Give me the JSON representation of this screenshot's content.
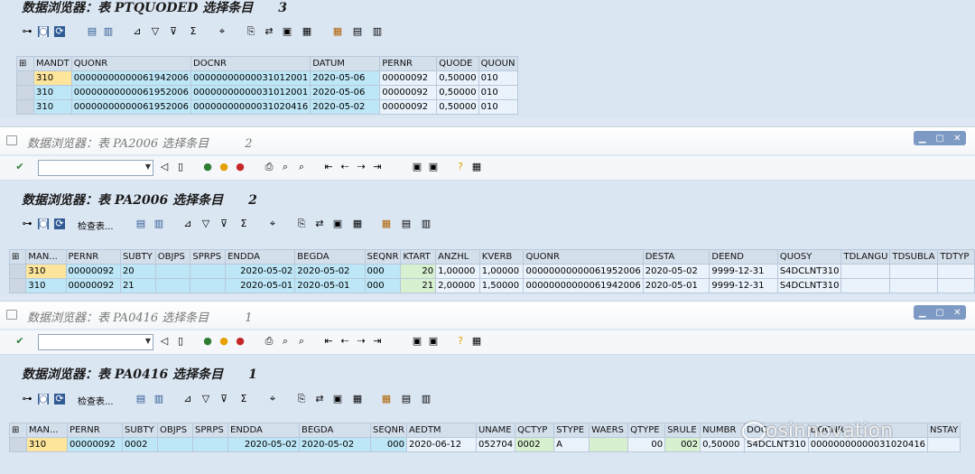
{
  "section1": {
    "title": "数据浏览器：表 PTQUODED 选择条目",
    "count": "3",
    "columns": [
      "MANDT",
      "QUONR",
      "DOCNR",
      "DATUM",
      "PERNR",
      "QUODE",
      "QUOUN"
    ],
    "rows": [
      [
        "310",
        "00000000000061942006",
        "00000000000031012001",
        "2020-05-06",
        "00000092",
        "0,50000",
        "010"
      ],
      [
        "310",
        "00000000000061952006",
        "00000000000031012001",
        "2020-05-06",
        "00000092",
        "0,50000",
        "010"
      ],
      [
        "310",
        "00000000000061952006",
        "00000000000031020416",
        "2020-05-02",
        "00000092",
        "0,50000",
        "010"
      ]
    ]
  },
  "window2": {
    "title": "数据浏览器：表 PA2006 选择条目",
    "count": "2"
  },
  "section2": {
    "title": "数据浏览器：表 PA2006 选择条目",
    "count": "2",
    "check_button": "检查表...",
    "columns": [
      "MAN...",
      "PERNR",
      "SUBTY",
      "OBJPS",
      "SPRPS",
      "ENDDA",
      "BEGDA",
      "SEQNR",
      "KTART",
      "ANZHL",
      "KVERB",
      "QUONR",
      "DESTA",
      "DEEND",
      "QUOSY",
      "TDLANGU",
      "TDSUBLA",
      "TDTYP"
    ],
    "rows": [
      [
        "310",
        "00000092",
        "20",
        "",
        "",
        "2020-05-02",
        "2020-05-02",
        "000",
        "20",
        "1,00000",
        "1,00000",
        "00000000000061952006",
        "2020-05-02",
        "9999-12-31",
        "S4DCLNT310",
        "",
        "",
        ""
      ],
      [
        "310",
        "00000092",
        "21",
        "",
        "",
        "2020-05-01",
        "2020-05-01",
        "000",
        "21",
        "2,00000",
        "1,50000",
        "00000000000061942006",
        "2020-05-01",
        "9999-12-31",
        "S4DCLNT310",
        "",
        "",
        ""
      ]
    ]
  },
  "window3": {
    "title": "数据浏览器：表 PA0416 选择条目",
    "count": "1"
  },
  "section3": {
    "title": "数据浏览器：表 PA0416 选择条目",
    "count": "1",
    "check_button": "检查表...",
    "columns": [
      "MAN...",
      "PERNR",
      "SUBTY",
      "OBJPS",
      "SPRPS",
      "ENDDA",
      "BEGDA",
      "SEQNR",
      "AEDTM",
      "UNAME",
      "QCTYP",
      "STYPE",
      "WAERS",
      "QTYPE",
      "SRULE",
      "NUMBR",
      "DOC",
      "DOCNR",
      "NSTAY"
    ],
    "rows": [
      [
        "310",
        "00000092",
        "0002",
        "",
        "",
        "2020-05-02",
        "2020-05-02",
        "000",
        "2020-06-12",
        "052704",
        "0002",
        "A",
        "",
        "00",
        "002",
        "0,50000",
        "S4DCLNT310",
        "00000000000031020416",
        ""
      ]
    ]
  },
  "watermark": "osinnovation",
  "colors": {
    "key_cell": "#fde59b",
    "data_cell": "#bde6f6",
    "green_cell": "#d7f0d0",
    "header": "#d4dfec",
    "window_control": "#7d9ac4"
  }
}
